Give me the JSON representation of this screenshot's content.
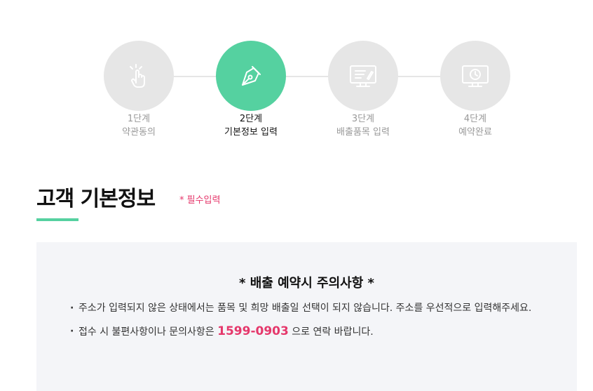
{
  "steps": [
    {
      "num": "1단계",
      "label": "약관동의",
      "icon": "hand-tap-icon",
      "active": false
    },
    {
      "num": "2단계",
      "label": "기본정보 입력",
      "icon": "pen-icon",
      "active": true
    },
    {
      "num": "3단계",
      "label": "배출품목 입력",
      "icon": "monitor-edit-icon",
      "active": false
    },
    {
      "num": "4단계",
      "label": "예약완료",
      "icon": "monitor-clock-icon",
      "active": false
    }
  ],
  "section": {
    "title": "고객 기본정보",
    "required_note": "* 필수입력"
  },
  "notice": {
    "title": "*  배출 예약시 주의사항  *",
    "item1": "주소가 입력되지 않은 상태에서는 품목 및 희망 배출일 선택이 되지 않습니다. 주소를 우선적으로 입력해주세요.",
    "item2_prefix": "접수 시 불편사항이나 문의사항은 ",
    "item2_phone": "1599-0903",
    "item2_suffix": " 으로 연락 바랍니다."
  },
  "colors": {
    "accent": "#55d1a0",
    "highlight": "#e5376b",
    "inactive": "#e6e6e6"
  }
}
